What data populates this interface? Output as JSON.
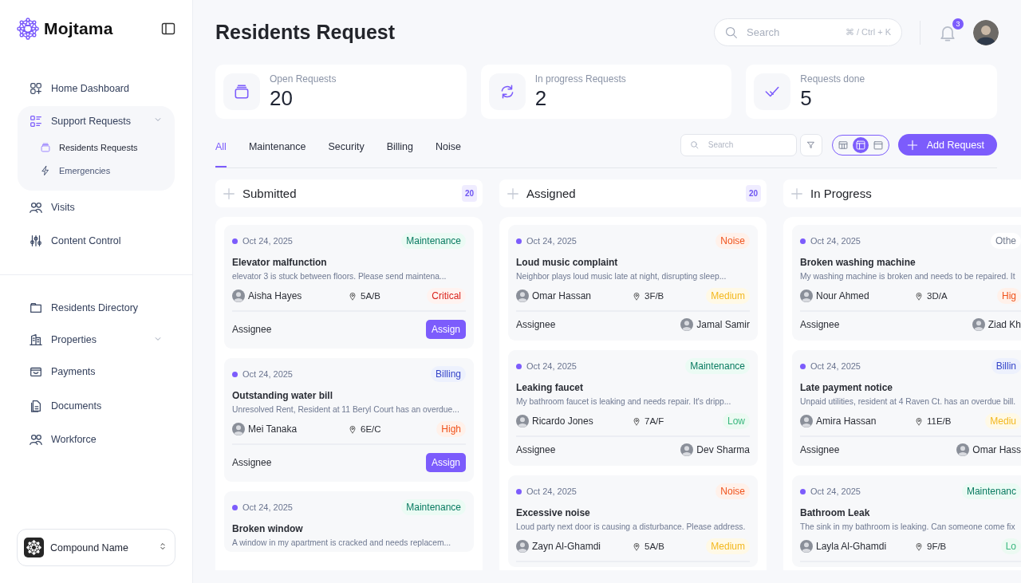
{
  "sidebar": {
    "brand": "Mojtama",
    "nav": [
      {
        "label": "Home Dashboard",
        "kind": "link"
      },
      {
        "label": "Support Requests",
        "kind": "group",
        "children": [
          {
            "label": "Residents Requests",
            "selected": true
          },
          {
            "label": "Emergencies",
            "selected": false
          }
        ]
      },
      {
        "label": "Visits",
        "kind": "link"
      },
      {
        "label": "Content Control",
        "kind": "link"
      }
    ],
    "nav2": [
      {
        "label": "Residents Directory",
        "kind": "link"
      },
      {
        "label": "Properties",
        "kind": "group"
      },
      {
        "label": "Payments",
        "kind": "link"
      },
      {
        "label": "Documents",
        "kind": "link"
      },
      {
        "label": "Workforce",
        "kind": "link"
      }
    ],
    "compound": "Compound Name"
  },
  "header": {
    "title": "Residents Request",
    "search": {
      "placeholder": "Search",
      "shortcut": "⌘ / Ctrl + K"
    },
    "notifications": "3"
  },
  "stats": [
    {
      "label": "Open Requests",
      "value": "20"
    },
    {
      "label": "In progress Requests",
      "value": "2"
    },
    {
      "label": "Requests done",
      "value": "5"
    }
  ],
  "tabs": [
    {
      "label": "All",
      "selected": true
    },
    {
      "label": "Maintenance",
      "selected": false
    },
    {
      "label": "Security",
      "selected": false
    },
    {
      "label": "Billing",
      "selected": false
    },
    {
      "label": "Noise",
      "selected": false
    }
  ],
  "toolbar": {
    "search": {
      "placeholder": "Search"
    },
    "views": [
      {
        "kind": "table",
        "selected": false
      },
      {
        "kind": "board",
        "selected": true
      },
      {
        "kind": "calendar",
        "selected": false
      }
    ],
    "add_button": "Add Request"
  },
  "columns": [
    {
      "title": "Submitted",
      "count": "20",
      "cards": [
        {
          "date": "Oct 24, 2025",
          "category": {
            "label": "Maintenance",
            "kind": "maintenance"
          },
          "title": "Elevator malfunction",
          "description": "elevator 3 is stuck between floors. Please send maintena...",
          "resident": "Aisha Hayes",
          "unit": "5A/B",
          "priority": {
            "label": "Critical",
            "kind": "critical"
          },
          "assignee_label": "Assignee",
          "assign_button": "Assign"
        },
        {
          "date": "Oct 24, 2025",
          "category": {
            "label": "Billing",
            "kind": "billing"
          },
          "title": "Outstanding water bill",
          "description": "Unresolved Rent, Resident at 11 Beryl Court has an overdue...",
          "resident": "Mei Tanaka",
          "unit": "6E/C",
          "priority": {
            "label": "High",
            "kind": "high"
          },
          "assignee_label": "Assignee",
          "assign_button": "Assign"
        },
        {
          "date": "Oct 24, 2025",
          "category": {
            "label": "Maintenance",
            "kind": "maintenance"
          },
          "title": "Broken window",
          "description": "A window in my apartment is cracked and needs replacem..."
        }
      ]
    },
    {
      "title": "Assigned",
      "count": "20",
      "cards": [
        {
          "date": "Oct 24, 2025",
          "category": {
            "label": "Noise",
            "kind": "noise"
          },
          "title": "Loud music complaint",
          "description": "Neighbor plays loud music late at night, disrupting sleep...",
          "resident": "Omar Hassan",
          "unit": "3F/B",
          "priority": {
            "label": "Medium",
            "kind": "medium"
          },
          "assignee_label": "Assignee",
          "assignee": "Jamal Samir"
        },
        {
          "date": "Oct 24, 2025",
          "category": {
            "label": "Maintenance",
            "kind": "maintenance"
          },
          "title": "Leaking faucet",
          "description": "My bathroom faucet is leaking and needs repair. It's dripp...",
          "resident": "Ricardo Jones",
          "unit": "7A/F",
          "priority": {
            "label": "Low",
            "kind": "low"
          },
          "assignee_label": "Assignee",
          "assignee": "Dev Sharma"
        },
        {
          "date": "Oct 24, 2025",
          "category": {
            "label": "Noise",
            "kind": "noise"
          },
          "title": "Excessive noise",
          "description": "Loud party next door is causing a disturbance. Please address.",
          "resident": "Zayn Al-Ghamdi",
          "unit": "5A/B",
          "priority": {
            "label": "Medium",
            "kind": "medium"
          }
        }
      ]
    },
    {
      "title": "In Progress",
      "cards": [
        {
          "date": "Oct 24, 2025",
          "category": {
            "label": "Othe",
            "kind": "other"
          },
          "title": "Broken washing machine",
          "description": "My washing machine is broken and needs to be repaired. It",
          "resident": "Nour Ahmed",
          "unit": "3D/A",
          "priority": {
            "label": "Hig",
            "kind": "high"
          },
          "assignee_label": "Assignee",
          "assignee": "Ziad Kh"
        },
        {
          "date": "Oct 24, 2025",
          "category": {
            "label": "Billin",
            "kind": "billing"
          },
          "title": "Late payment notice",
          "description": "Unpaid utilities, resident at 4 Raven Ct. has an overdue bill.",
          "resident": "Amira Hassan",
          "unit": "11E/B",
          "priority": {
            "label": "Mediu",
            "kind": "medium"
          },
          "assignee_label": "Assignee",
          "assignee": "Omar Hass"
        },
        {
          "date": "Oct 24, 2025",
          "category": {
            "label": "Maintenanc",
            "kind": "maintenance"
          },
          "title": "Bathroom Leak",
          "description": "The sink in my bathroom is leaking. Can someone come fix",
          "resident": "Layla Al-Ghamdi",
          "unit": "9F/B",
          "priority": {
            "label": "Lo",
            "kind": "low"
          }
        }
      ]
    }
  ]
}
